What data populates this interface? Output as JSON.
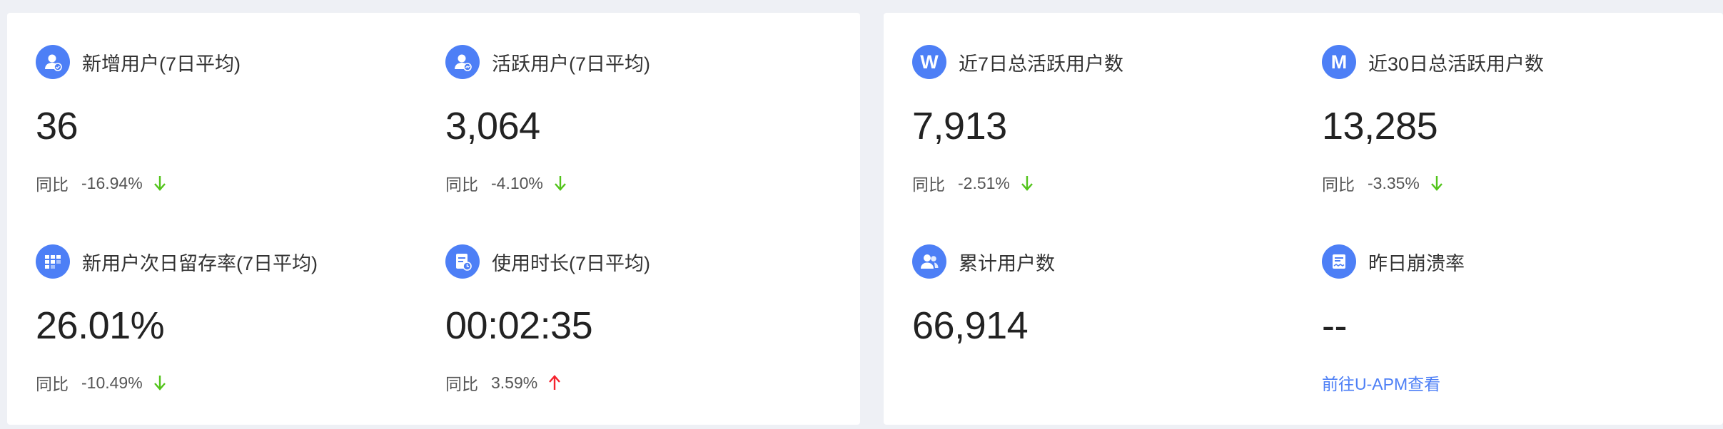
{
  "left_panel": {
    "metrics": [
      {
        "title": "新增用户(7日平均)",
        "value": "36",
        "compare_label": "同比",
        "compare_value": "-16.94%",
        "trend": "down",
        "icon": "new-user-icon"
      },
      {
        "title": "活跃用户(7日平均)",
        "value": "3,064",
        "compare_label": "同比",
        "compare_value": "-4.10%",
        "trend": "down",
        "icon": "active-user-icon"
      },
      {
        "title": "新用户次日留存率(7日平均)",
        "value": "26.01%",
        "compare_label": "同比",
        "compare_value": "-10.49%",
        "trend": "down",
        "icon": "retention-grid-icon"
      },
      {
        "title": "使用时长(7日平均)",
        "value": "00:02:35",
        "compare_label": "同比",
        "compare_value": "3.59%",
        "trend": "up",
        "icon": "usage-time-icon"
      }
    ]
  },
  "right_panel": {
    "metrics": [
      {
        "title": "近7日总活跃用户数",
        "value": "7,913",
        "compare_label": "同比",
        "compare_value": "-2.51%",
        "trend": "down",
        "icon_letter": "W"
      },
      {
        "title": "近30日总活跃用户数",
        "value": "13,285",
        "compare_label": "同比",
        "compare_value": "-3.35%",
        "trend": "down",
        "icon_letter": "M"
      },
      {
        "title": "累计用户数",
        "value": "66,914",
        "icon": "users-group-icon"
      },
      {
        "title": "昨日崩溃率",
        "value": "--",
        "link_text": "前往U-APM查看",
        "icon": "crash-report-icon"
      }
    ]
  },
  "colors": {
    "accent": "#4d7ff6",
    "trend_down": "#52c41a",
    "trend_up": "#f5222d",
    "background": "#eef0f5"
  }
}
